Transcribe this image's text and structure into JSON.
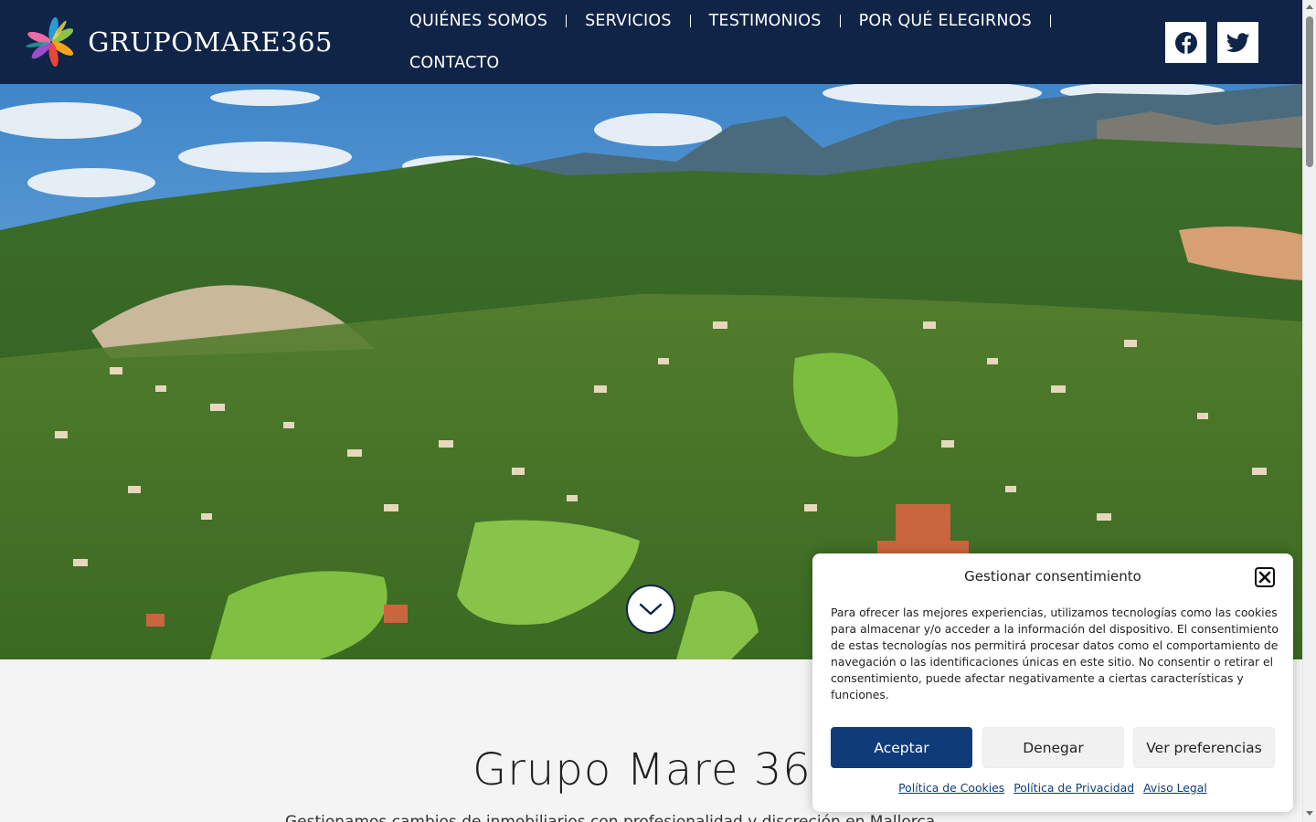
{
  "brand": {
    "name": "GRUPOMARE365"
  },
  "nav": {
    "items": [
      {
        "label": "QUIÉNES SOMOS"
      },
      {
        "label": "SERVICIOS"
      },
      {
        "label": "TESTIMONIOS"
      },
      {
        "label": "POR QUÉ ELEGIRNOS"
      },
      {
        "label": "CONTACTO"
      }
    ]
  },
  "social": {
    "icons": [
      "facebook-icon",
      "twitter-icon"
    ]
  },
  "hero": {
    "scroll_icon": "chevron-down-icon"
  },
  "section": {
    "title": "Grupo Mare 365",
    "subtitle": "Gestionamos cambios de inmobiliarios con profesionalidad y discreción en Mallorca"
  },
  "consent": {
    "title": "Gestionar consentimiento",
    "text": "Para ofrecer las mejores experiencias, utilizamos tecnologías como las cookies para almacenar y/o acceder a la información del dispositivo. El consentimiento de estas tecnologías nos permitirá procesar datos como el comportamiento de navegación o las identificaciones únicas en este sitio. No consentir o retirar el consentimiento, puede afectar negativamente a ciertas características y funciones.",
    "accept": "Aceptar",
    "deny": "Denegar",
    "preferences": "Ver preferencias",
    "links": [
      "Política de Cookies",
      "Política de Privacidad",
      "Aviso Legal"
    ]
  },
  "colors": {
    "navy": "#0f2447",
    "accent": "#0f3c78"
  }
}
